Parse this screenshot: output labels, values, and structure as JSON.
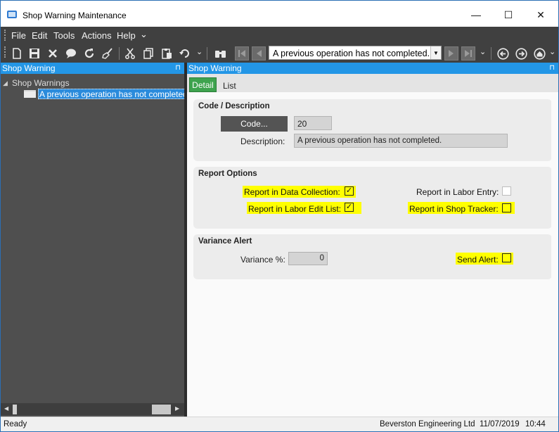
{
  "window": {
    "title": "Shop Warning Maintenance",
    "minimize": "—",
    "maximize": "☐",
    "close": "✕"
  },
  "menu": {
    "items": [
      "File",
      "Edit",
      "Tools",
      "Actions",
      "Help"
    ],
    "overflow": "⌄"
  },
  "toolbar": {
    "icons": [
      "new-icon",
      "save-icon",
      "delete-icon",
      "comment-icon",
      "refresh-icon",
      "clear-icon",
      "cut-icon",
      "copy-icon",
      "paste-icon",
      "undo-icon",
      "search-icon",
      "first-record-icon",
      "previous-record-icon",
      "next-record-icon",
      "last-record-icon",
      "back-icon",
      "forward-icon",
      "home-icon"
    ],
    "record_combo_value": "A previous operation has not completed."
  },
  "left_pane": {
    "header": "Shop Warning",
    "pin": "⊓",
    "tree_root": "Shop Warnings",
    "tree_items": [
      "A previous operation has not completed."
    ]
  },
  "right_pane": {
    "header": "Shop Warning",
    "pin": "⊓",
    "tabs": [
      {
        "label": "Detail",
        "active": true
      },
      {
        "label": "List",
        "active": false
      }
    ]
  },
  "code_description": {
    "title": "Code / Description",
    "code_button": "Code...",
    "code_value": "20",
    "description_label": "Description:",
    "description_value": "A previous operation has not completed."
  },
  "report_options": {
    "title": "Report Options",
    "options": [
      {
        "label": "Report in Data Collection:",
        "checked": true,
        "highlighted": true
      },
      {
        "label": "Report in Labor Entry:",
        "checked": false,
        "highlighted": false
      },
      {
        "label": "Report in Labor Edit List:",
        "checked": true,
        "highlighted": true
      },
      {
        "label": "Report in Shop Tracker:",
        "checked": false,
        "highlighted": true
      }
    ]
  },
  "variance_alert": {
    "title": "Variance Alert",
    "variance_label": "Variance %:",
    "variance_value": "0",
    "send_alert_label": "Send Alert:",
    "send_alert_checked": false
  },
  "status_bar": {
    "status": "Ready",
    "company": "Beverston Engineering Ltd",
    "date": "11/07/2019",
    "time": "10:44"
  },
  "colors": {
    "pane_header": "#2396e6",
    "active_tab": "#3ea34e",
    "highlight": "#ffff00",
    "dark_chrome": "#404040"
  }
}
